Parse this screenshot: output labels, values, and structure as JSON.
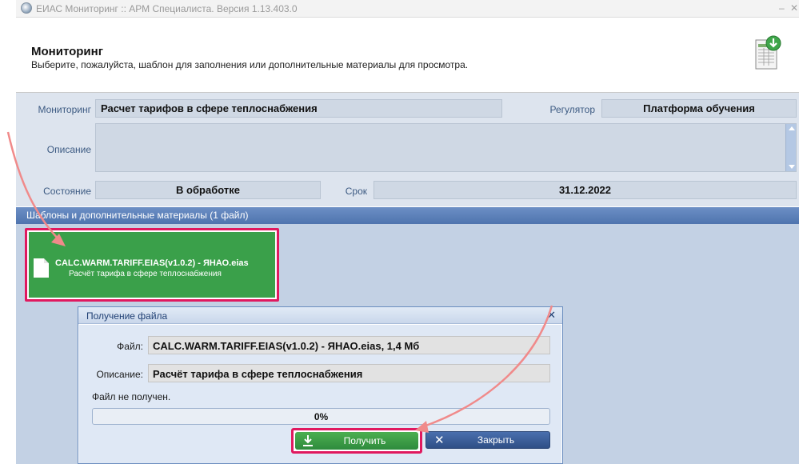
{
  "window": {
    "title": "ЕИАС Мониторинг :: АРМ Специалиста. Версия 1.13.403.0",
    "minimize": "–",
    "close": "✕"
  },
  "header": {
    "title": "Мониторинг",
    "subtitle": "Выберите, пожалуйста, шаблон для заполнения или дополнительные материалы для просмотра.",
    "icon": "spreadsheet-download-icon"
  },
  "form": {
    "monitoring_label": "Мониторинг",
    "monitoring_value": "Расчет тарифов в сфере теплоснабжения",
    "regulator_label": "Регулятор",
    "regulator_value": "Платформа обучения",
    "description_label": "Описание",
    "description_value": "",
    "state_label": "Состояние",
    "state_value": "В обработке",
    "deadline_label": "Срок",
    "deadline_value": "31.12.2022"
  },
  "files_section": {
    "title": "Шаблоны и дополнительные материалы (1 файл)",
    "files": [
      {
        "name": "CALC.WARM.TARIFF.EIAS(v1.0.2) - ЯНАО.eias",
        "description": "Расчёт тарифа в сфере теплоснабжения",
        "icon": "file-icon"
      }
    ]
  },
  "dialog": {
    "title": "Получение файла",
    "close": "✕",
    "file_label": "Файл:",
    "file_value": "CALC.WARM.TARIFF.EIAS(v1.0.2) - ЯНАО.eias, 1,4 Мб",
    "description_label": "Описание:",
    "description_value": "Расчёт тарифа в сфере теплоснабжения",
    "status": "Файл не получен.",
    "progress_percent": 0,
    "progress_text": "0%",
    "get_button": "Получить",
    "close_button": "Закрыть"
  },
  "colors": {
    "accent_highlight": "#e0195f",
    "tile_green": "#3aa04a",
    "section_blue": "#5b7fb9",
    "callout_arrow": "#f08a8a"
  }
}
